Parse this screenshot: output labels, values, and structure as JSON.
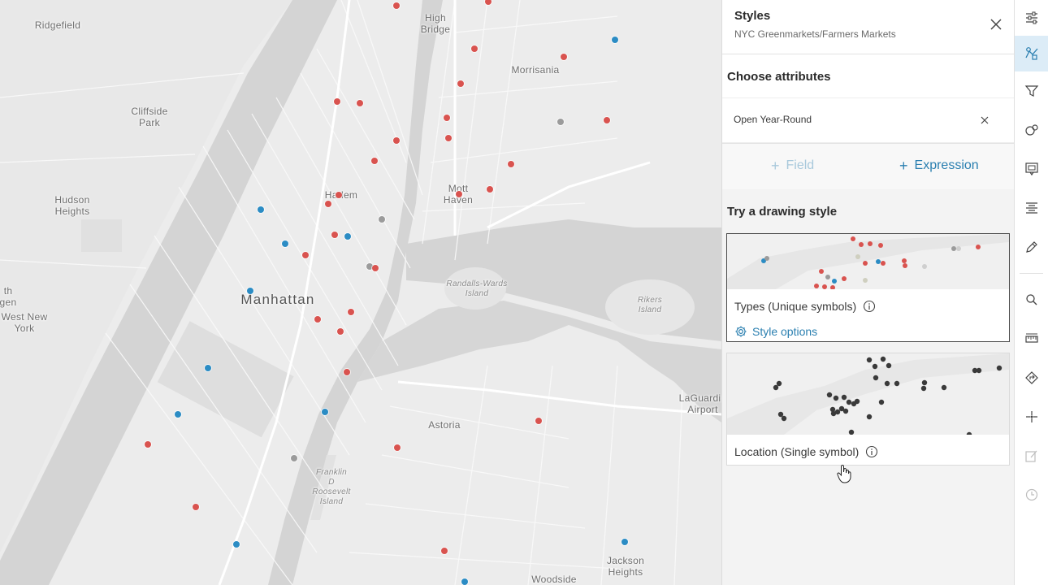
{
  "map": {
    "labels": [
      {
        "text": "Ridgefield",
        "kind": "place"
      },
      {
        "text": "High\nBridge",
        "kind": "place"
      },
      {
        "text": "Morrisania",
        "kind": "place"
      },
      {
        "text": "Cliffside\nPark",
        "kind": "place"
      },
      {
        "text": "Hudson\nHeights",
        "kind": "place"
      },
      {
        "text": "Harlem",
        "kind": "place"
      },
      {
        "text": "Mott\nHaven",
        "kind": "place"
      },
      {
        "text": "Manhattan",
        "kind": "borough"
      },
      {
        "text": "Randalls-Wards\nIsland",
        "kind": "water"
      },
      {
        "text": "Rikers\nIsland",
        "kind": "water"
      },
      {
        "text": "LaGuardia\nAirport",
        "kind": "place"
      },
      {
        "text": "Astoria",
        "kind": "place"
      },
      {
        "text": "Franklin\nD\nRoosevelt\nIsland",
        "kind": "water"
      },
      {
        "text": "Jackson\nHeights",
        "kind": "place"
      },
      {
        "text": "Woodside",
        "kind": "place"
      },
      {
        "text": "West New\nYork",
        "kind": "place"
      },
      {
        "text": "th\ngen",
        "kind": "place"
      }
    ],
    "point_colors": {
      "red": "#d9534f",
      "blue": "#2b8cc4",
      "gray": "#9b9b9b"
    }
  },
  "panel": {
    "title": "Styles",
    "subtitle": "NYC Greenmarkets/Farmers Markets",
    "choose_heading": "Choose attributes",
    "attribute": "Open Year-Round",
    "add_field_label": "Field",
    "add_expression_label": "Expression",
    "try_heading": "Try a drawing style",
    "cards": [
      {
        "label": "Types (Unique symbols)",
        "selected": true,
        "options_label": "Style options"
      },
      {
        "label": "Location (Single symbol)",
        "selected": false
      }
    ]
  },
  "toolbar": {
    "tools": [
      {
        "name": "properties",
        "icon": "sliders-icon"
      },
      {
        "name": "styles",
        "icon": "styles-icon",
        "active": true
      },
      {
        "name": "filter",
        "icon": "filter-icon"
      },
      {
        "name": "effects",
        "icon": "effects-icon"
      },
      {
        "name": "pop-ups",
        "icon": "popup-icon"
      },
      {
        "name": "labels",
        "icon": "labels-icon"
      },
      {
        "name": "sketch",
        "icon": "sketch-icon"
      },
      {
        "name": "search",
        "icon": "search-icon"
      },
      {
        "name": "measure",
        "icon": "measure-icon"
      },
      {
        "name": "directions",
        "icon": "directions-icon"
      },
      {
        "name": "location",
        "icon": "crosshair-icon"
      },
      {
        "name": "edit",
        "icon": "edit-icon",
        "disabled": true
      },
      {
        "name": "time",
        "icon": "clock-icon",
        "disabled": true
      }
    ]
  }
}
